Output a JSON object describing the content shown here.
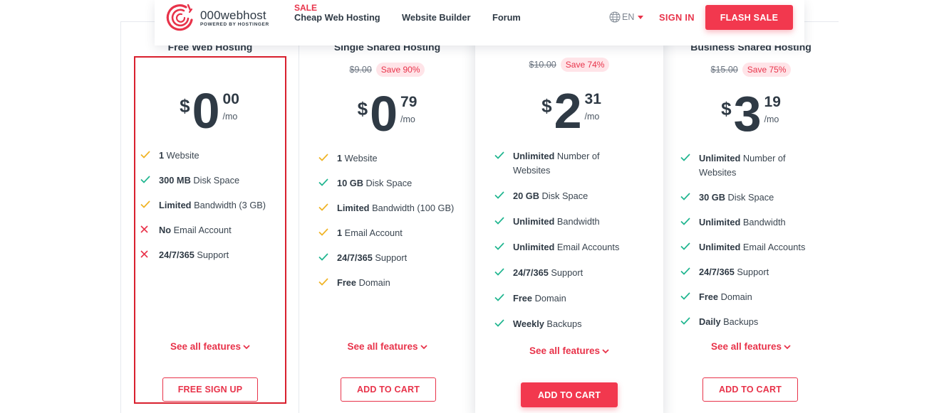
{
  "header": {
    "logo_name": "000webhost",
    "logo_sub": "POWERED BY HOSTINGER",
    "sale_tag": "SALE",
    "nav_cheap": "Cheap Web Hosting",
    "nav_builder": "Website Builder",
    "nav_forum": "Forum",
    "lang": "EN",
    "signin": "SIGN IN",
    "flash_sale": "FLASH SALE"
  },
  "colors": {
    "accent": "#f2384e",
    "check_green": "#1fb58f",
    "check_yellow": "#f0b323",
    "cross_red": "#e8334a"
  },
  "plans": [
    {
      "title": "Free Web Hosting",
      "old_price": "",
      "save": "",
      "currency": "$",
      "whole": "0",
      "cents": "00",
      "per": "/mo",
      "features": [
        {
          "icon": "check-yellow",
          "bold": "1",
          "text": " Website"
        },
        {
          "icon": "check-green",
          "bold": "300 MB",
          "text": " Disk Space"
        },
        {
          "icon": "check-yellow",
          "bold": "Limited",
          "text": " Bandwidth (3 GB)"
        },
        {
          "icon": "cross-red",
          "bold": "No",
          "text": " Email Account"
        },
        {
          "icon": "cross-red",
          "bold": "24/7/365",
          "text": " Support"
        }
      ],
      "see_all": "See all features",
      "cta": "FREE SIGN UP"
    },
    {
      "title": "Single Shared Hosting",
      "old_price": "$9.00",
      "save": "Save 90%",
      "currency": "$",
      "whole": "0",
      "cents": "79",
      "per": "/mo",
      "features": [
        {
          "icon": "check-yellow",
          "bold": "1",
          "text": " Website"
        },
        {
          "icon": "check-green",
          "bold": "10 GB",
          "text": " Disk Space"
        },
        {
          "icon": "check-yellow",
          "bold": "Limited",
          "text": " Bandwidth (100 GB)"
        },
        {
          "icon": "check-yellow",
          "bold": "1",
          "text": " Email Account"
        },
        {
          "icon": "check-green",
          "bold": "24/7/365",
          "text": " Support"
        },
        {
          "icon": "check-yellow",
          "bold": "Free",
          "text": " Domain"
        }
      ],
      "see_all": "See all features",
      "cta": "ADD TO CART"
    },
    {
      "title": "",
      "old_price": "$10.00",
      "save": "Save 74%",
      "currency": "$",
      "whole": "2",
      "cents": "31",
      "per": "/mo",
      "features": [
        {
          "icon": "check-green",
          "bold": "Unlimited",
          "text": " Number of Websites"
        },
        {
          "icon": "check-green",
          "bold": "20 GB",
          "text": " Disk Space"
        },
        {
          "icon": "check-green",
          "bold": "Unlimited",
          "text": " Bandwidth"
        },
        {
          "icon": "check-green",
          "bold": "Unlimited",
          "text": " Email Accounts"
        },
        {
          "icon": "check-green",
          "bold": "24/7/365",
          "text": " Support"
        },
        {
          "icon": "check-green",
          "bold": "Free",
          "text": " Domain"
        },
        {
          "icon": "check-green",
          "bold": "Weekly",
          "text": " Backups"
        }
      ],
      "see_all": "See all features",
      "cta": "ADD TO CART"
    },
    {
      "title": "Business Shared Hosting",
      "old_price": "$15.00",
      "save": "Save 75%",
      "currency": "$",
      "whole": "3",
      "cents": "19",
      "per": "/mo",
      "features": [
        {
          "icon": "check-green",
          "bold": "Unlimited",
          "text": " Number of Websites"
        },
        {
          "icon": "check-green",
          "bold": "30 GB",
          "text": " Disk Space"
        },
        {
          "icon": "check-green",
          "bold": "Unlimited",
          "text": " Bandwidth"
        },
        {
          "icon": "check-green",
          "bold": "Unlimited",
          "text": " Email Accounts"
        },
        {
          "icon": "check-green",
          "bold": "24/7/365",
          "text": " Support"
        },
        {
          "icon": "check-green",
          "bold": "Free",
          "text": " Domain"
        },
        {
          "icon": "check-green",
          "bold": "Daily",
          "text": " Backups"
        }
      ],
      "see_all": "See all features",
      "cta": "ADD TO CART"
    }
  ]
}
